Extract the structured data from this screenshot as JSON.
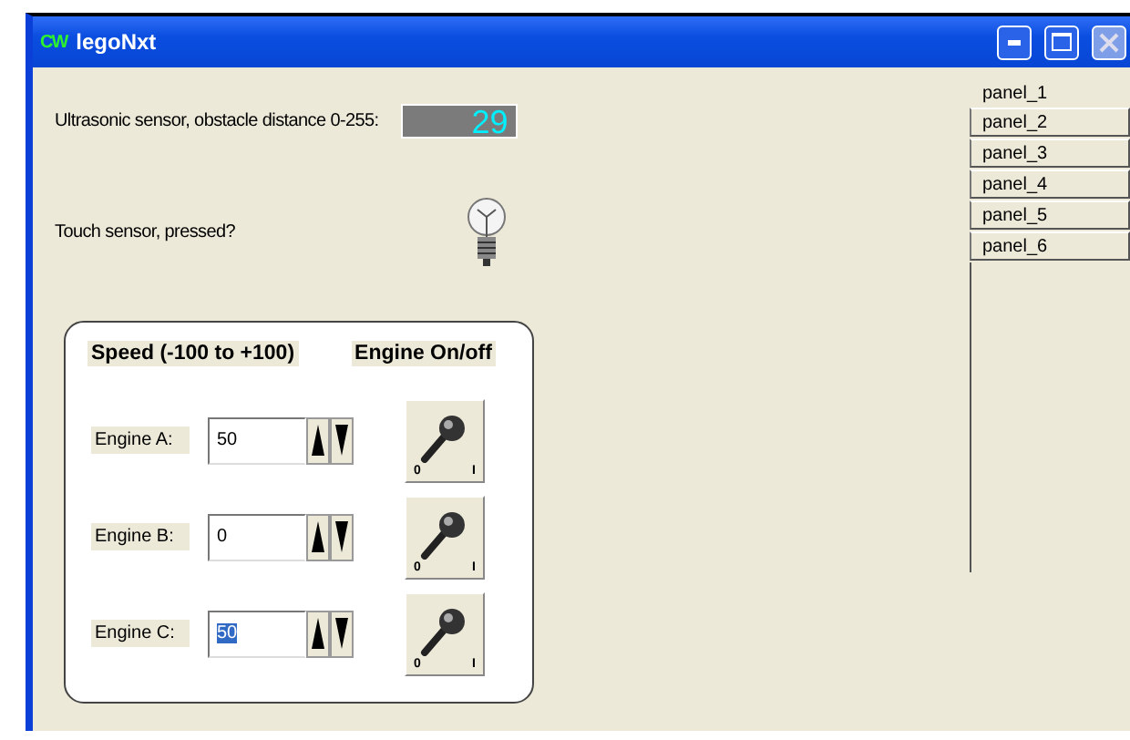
{
  "window": {
    "title": "legoNxt",
    "app_badge": "CW"
  },
  "ultrasonic": {
    "label": "Ultrasonic sensor,  obstacle distance 0-255:",
    "reading": "29"
  },
  "touch": {
    "label": "Touch sensor, pressed?",
    "pressed": false
  },
  "engines": {
    "speed_heading": "Speed (-100 to +100)",
    "switch_heading": "Engine On/off",
    "rows": [
      {
        "label": "Engine A:",
        "value": "50",
        "text_selected": false,
        "switch_on": false,
        "switch_off_label": "0",
        "switch_on_label": "I"
      },
      {
        "label": "Engine B:",
        "value": "0",
        "text_selected": false,
        "switch_on": false,
        "switch_off_label": "0",
        "switch_on_label": "I"
      },
      {
        "label": "Engine C:",
        "value": "50",
        "text_selected": true,
        "switch_on": false,
        "switch_off_label": "0",
        "switch_on_label": "I"
      }
    ]
  },
  "panels": [
    {
      "label": "panel_1",
      "selected": true
    },
    {
      "label": "panel_2",
      "selected": false
    },
    {
      "label": "panel_3",
      "selected": false
    },
    {
      "label": "panel_4",
      "selected": false
    },
    {
      "label": "panel_5",
      "selected": false
    },
    {
      "label": "panel_6",
      "selected": false
    }
  ]
}
